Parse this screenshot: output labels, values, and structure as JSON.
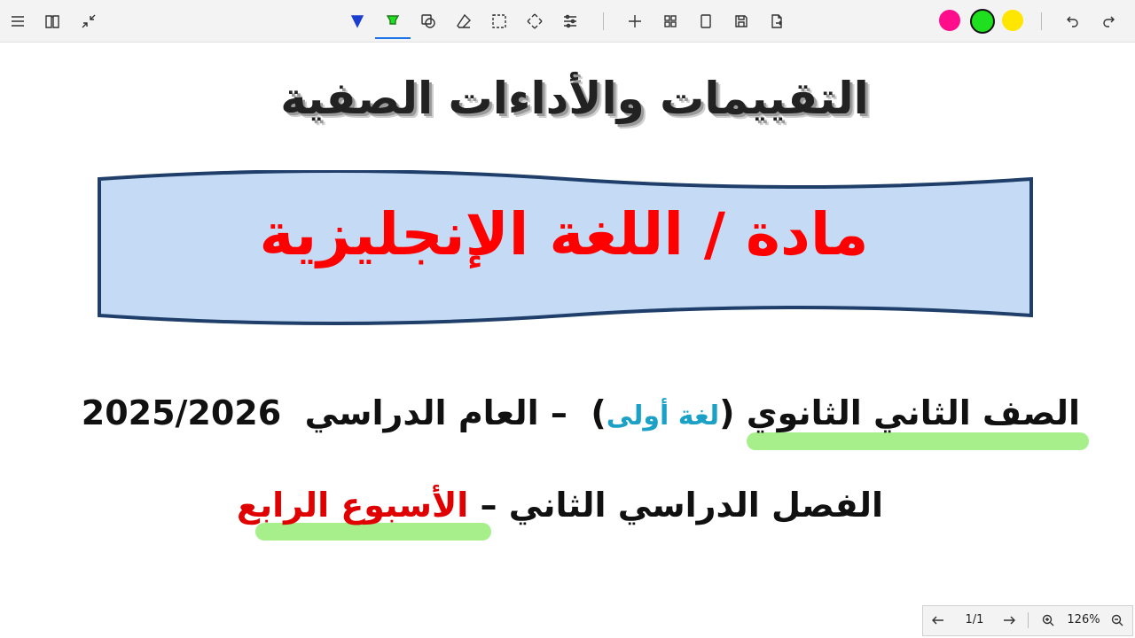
{
  "toolbar": {
    "colors": {
      "pink": "#ff0d8a",
      "green": "#1ee01e",
      "yellow": "#ffe600",
      "active_underline": "#1a73e8"
    },
    "icons": [
      "menu-icon",
      "book-icon",
      "collapse-icon",
      "pen-icon",
      "highlighter-icon",
      "shapes-icon",
      "eraser-icon",
      "lasso-select-icon",
      "move-icon",
      "settings-sliders-icon",
      "add-icon",
      "grid-icon",
      "page-icon",
      "save-icon",
      "export-icon",
      "undo-icon",
      "redo-icon"
    ]
  },
  "document": {
    "title": "التقييمات والأداءات الصفية",
    "banner_text": "مادة / اللغة الإنجليزية",
    "line1": {
      "grade": "الصف الثاني الثانوي",
      "open_paren": "(",
      "language": "لغة أولى",
      "close_paren": ")",
      "dash": "–",
      "year_label": "العام الدراسي",
      "year": "2025/2026"
    },
    "line2": {
      "term": "الفصل الدراسي الثاني",
      "dash": "–",
      "week": "الأسبوع الرابع"
    },
    "colors": {
      "banner_fill": "#c5daf5",
      "banner_stroke": "#1f3f6a",
      "banner_text": "#ff0000",
      "highlight": "#a6ef8b",
      "language": "#1ba1c6",
      "week": "#e00000"
    }
  },
  "pager": {
    "page": "1/1",
    "zoom": "126%",
    "icons": [
      "arrow-left-icon",
      "arrow-right-icon",
      "zoom-in-icon",
      "zoom-out-icon"
    ]
  }
}
